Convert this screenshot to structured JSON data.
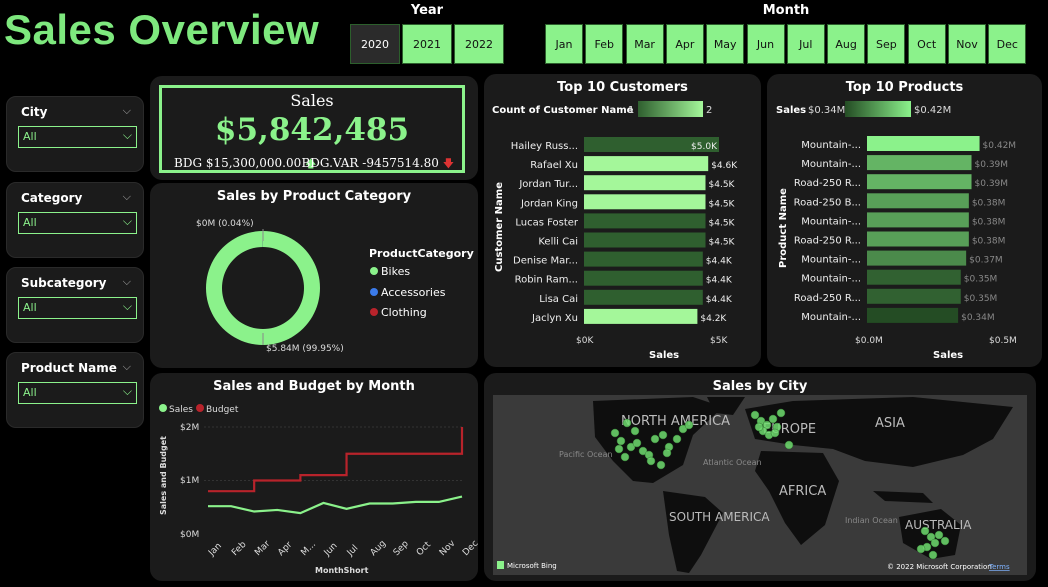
{
  "title": "Sales Overview",
  "year_slicer": {
    "label": "Year",
    "options": [
      "2020",
      "2021",
      "2022"
    ],
    "selected": "2020"
  },
  "month_slicer": {
    "label": "Month",
    "options": [
      "Jan",
      "Feb",
      "Mar",
      "Apr",
      "May",
      "Jun",
      "Jul",
      "Aug",
      "Sep",
      "Oct",
      "Nov",
      "Dec"
    ]
  },
  "filters": [
    {
      "label": "City",
      "value": "All"
    },
    {
      "label": "Category",
      "value": "All"
    },
    {
      "label": "Subcategory",
      "value": "All"
    },
    {
      "label": "Product Name",
      "value": "All"
    }
  ],
  "kpi": {
    "label": "Sales",
    "value": "$5,842,485",
    "budget_text": "BDG $15,300,000.00",
    "variance_text": "BDG.VAR -9457514.80",
    "up_arrow": "🡅",
    "down_arrow": "🡇"
  },
  "icons": {
    "chevron": "⌵",
    "dropdown_chevron": "⌵"
  },
  "colors": {
    "accent": "#8bf28b",
    "bikes": "#8bf28b",
    "accessories": "#3b7bea",
    "clothing": "#b8232b",
    "budget_line": "#b8232b",
    "sales_line": "#8bf28b"
  },
  "donut": {
    "title": "Sales by Product Category",
    "legend_title": "ProductCategory",
    "label_small": "$0M (0.04%)",
    "label_large": "$5.84M (99.95%)",
    "chart_data": {
      "type": "pie",
      "categories": [
        "Bikes",
        "Accessories",
        "Clothing"
      ],
      "values": [
        99.95,
        0.04,
        0.01
      ]
    }
  },
  "line": {
    "title": "Sales and Budget by Month",
    "legend_sales": "Sales",
    "legend_budget": "Budget",
    "ylabel": "Sales and Budget",
    "xlabel": "MonthShort",
    "y_ticks": [
      "$0M",
      "$1M",
      "$2M"
    ],
    "chart_data": {
      "type": "line",
      "categories": [
        "Jan",
        "Feb",
        "Mar",
        "Apr",
        "M...",
        "Jun",
        "Jul",
        "Aug",
        "Sep",
        "Oct",
        "Nov",
        "Dec"
      ],
      "series": [
        {
          "name": "Sales",
          "values": [
            0.52,
            0.52,
            0.42,
            0.45,
            0.39,
            0.58,
            0.47,
            0.57,
            0.57,
            0.6,
            0.6,
            0.7
          ]
        },
        {
          "name": "Budget",
          "values": [
            0.8,
            0.8,
            1.0,
            1.0,
            1.1,
            1.1,
            1.5,
            1.5,
            1.5,
            1.5,
            1.5,
            2.0
          ]
        }
      ],
      "ylim": [
        0,
        2
      ]
    }
  },
  "customers": {
    "title": "Top 10 Customers",
    "legend_label": "Count of Customer Name",
    "legend_min": "1",
    "legend_max": "2",
    "ylabel": "Customer Name",
    "xlabel": "Sales",
    "x_ticks": [
      "$0K",
      "$5K"
    ],
    "chart_data": {
      "type": "bar",
      "categories": [
        "Hailey Russ...",
        "Rafael Xu",
        "Jordan Tur...",
        "Jordan King",
        "Lucas Foster",
        "Kelli Cai",
        "Denise Mar...",
        "Robin Ram...",
        "Lisa Cai",
        "Jaclyn Xu"
      ],
      "values": [
        5.0,
        4.6,
        4.5,
        4.5,
        4.5,
        4.5,
        4.4,
        4.4,
        4.4,
        4.2
      ],
      "labels": [
        "$5.0K",
        "$4.6K",
        "$4.5K",
        "$4.5K",
        "$4.5K",
        "$4.5K",
        "$4.4K",
        "$4.4K",
        "$4.4K",
        "$4.2K"
      ],
      "counts": [
        1,
        2,
        2,
        2,
        1,
        1,
        1,
        1,
        1,
        2
      ],
      "xlim": [
        0,
        5
      ]
    }
  },
  "products": {
    "title": "Top 10 Products",
    "legend_label": "Sales",
    "legend_min": "$0.34M",
    "legend_max": "$0.42M",
    "ylabel": "Product Name",
    "xlabel": "Sales",
    "x_ticks": [
      "$0.0M",
      "$0.5M"
    ],
    "chart_data": {
      "type": "bar",
      "categories": [
        "Mountain-...",
        "Mountain-...",
        "Road-250 R...",
        "Road-250 B...",
        "Mountain-...",
        "Road-250 R...",
        "Mountain-...",
        "Mountain-...",
        "Road-250 R...",
        "Mountain-..."
      ],
      "values": [
        0.42,
        0.39,
        0.39,
        0.38,
        0.38,
        0.38,
        0.37,
        0.35,
        0.35,
        0.34
      ],
      "labels": [
        "$0.42M",
        "$0.39M",
        "$0.39M",
        "$0.38M",
        "$0.38M",
        "$0.38M",
        "$0.37M",
        "$0.35M",
        "$0.35M",
        "$0.34M"
      ],
      "xlim": [
        0,
        0.5
      ]
    }
  },
  "map": {
    "title": "Sales by City",
    "regions": [
      "NORTH AMERICA",
      "EUROPE",
      "ASIA",
      "AFRICA",
      "SOUTH AMERICA",
      "AUSTRALIA"
    ],
    "oceans": [
      "Pacific Ocean",
      "Atlantic Ocean",
      "Indian Ocean"
    ],
    "attribution": "© 2022 Microsoft Corporation",
    "terms": "Terms",
    "logo": "Microsoft Bing"
  }
}
